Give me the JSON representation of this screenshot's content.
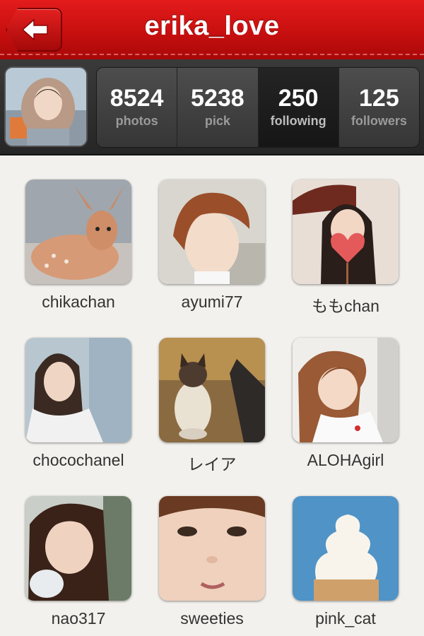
{
  "header": {
    "title": "erika_love",
    "back_icon": "back-arrow-icon"
  },
  "stats": [
    {
      "count": "8524",
      "label": "photos",
      "active": false
    },
    {
      "count": "5238",
      "label": "pick",
      "active": false
    },
    {
      "count": "250",
      "label": "following",
      "active": true
    },
    {
      "count": "125",
      "label": "followers",
      "active": false
    }
  ],
  "users": [
    {
      "name": "chikachan"
    },
    {
      "name": "ayumi77"
    },
    {
      "name": "ももchan"
    },
    {
      "name": "chocochanel"
    },
    {
      "name": "レイア"
    },
    {
      "name": "ALOHAgirl"
    },
    {
      "name": "nao317"
    },
    {
      "name": "sweeties"
    },
    {
      "name": "pink_cat"
    }
  ],
  "colors": {
    "header_red": "#c80f0f",
    "stats_bg": "#2e2e2e",
    "page_bg": "#f3f1ed"
  }
}
